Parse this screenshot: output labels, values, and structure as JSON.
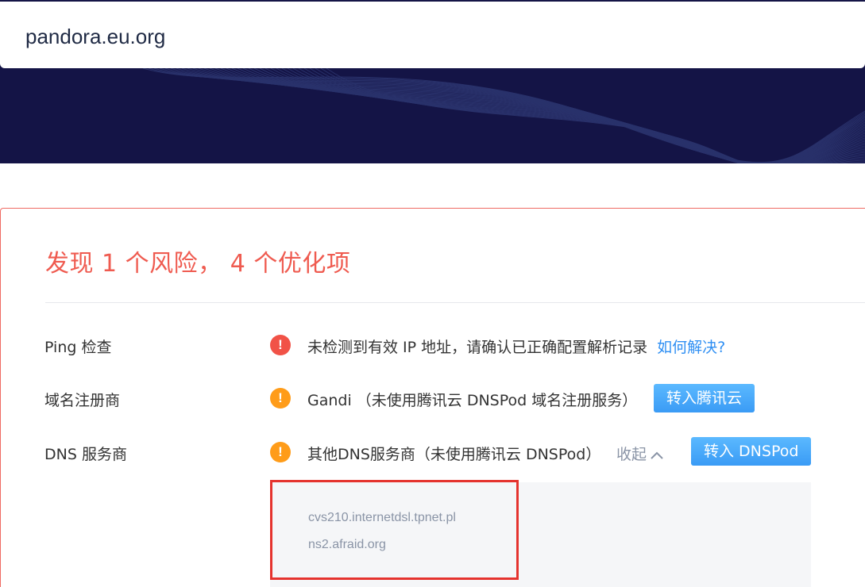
{
  "search": {
    "value": "pandora.eu.org"
  },
  "summary": {
    "title": "发现 1 个风险， 4 个优化项"
  },
  "checks": [
    {
      "label": "Ping 检查",
      "status": "risk",
      "message": "未检测到有效 IP 地址，请确认已正确配置解析记录",
      "link": "如何解决?"
    },
    {
      "label": "域名注册商",
      "status": "warning",
      "message": "Gandi （未使用腾讯云 DNSPod 域名注册服务）",
      "button": "转入腾讯云"
    },
    {
      "label": "DNS 服务商",
      "status": "warning",
      "message": "其他DNS服务商（未使用腾讯云 DNSPod）",
      "toggle": "收起",
      "button": "转入 DNSPod"
    }
  ],
  "nameservers": [
    "cvs210.internetdsl.tpnet.pl",
    "ns2.afraid.org"
  ],
  "icons": {
    "risk": "exclamation-circle-icon",
    "warning": "exclamation-circle-icon",
    "toggle": "chevron-up-icon"
  },
  "colors": {
    "hero_bg": "#141446",
    "risk": "#f15247",
    "warning": "#ff9c19",
    "link": "#2f8ff3",
    "button": "#3a9bf5",
    "title": "#ef5b50",
    "highlight": "#e5332e"
  }
}
